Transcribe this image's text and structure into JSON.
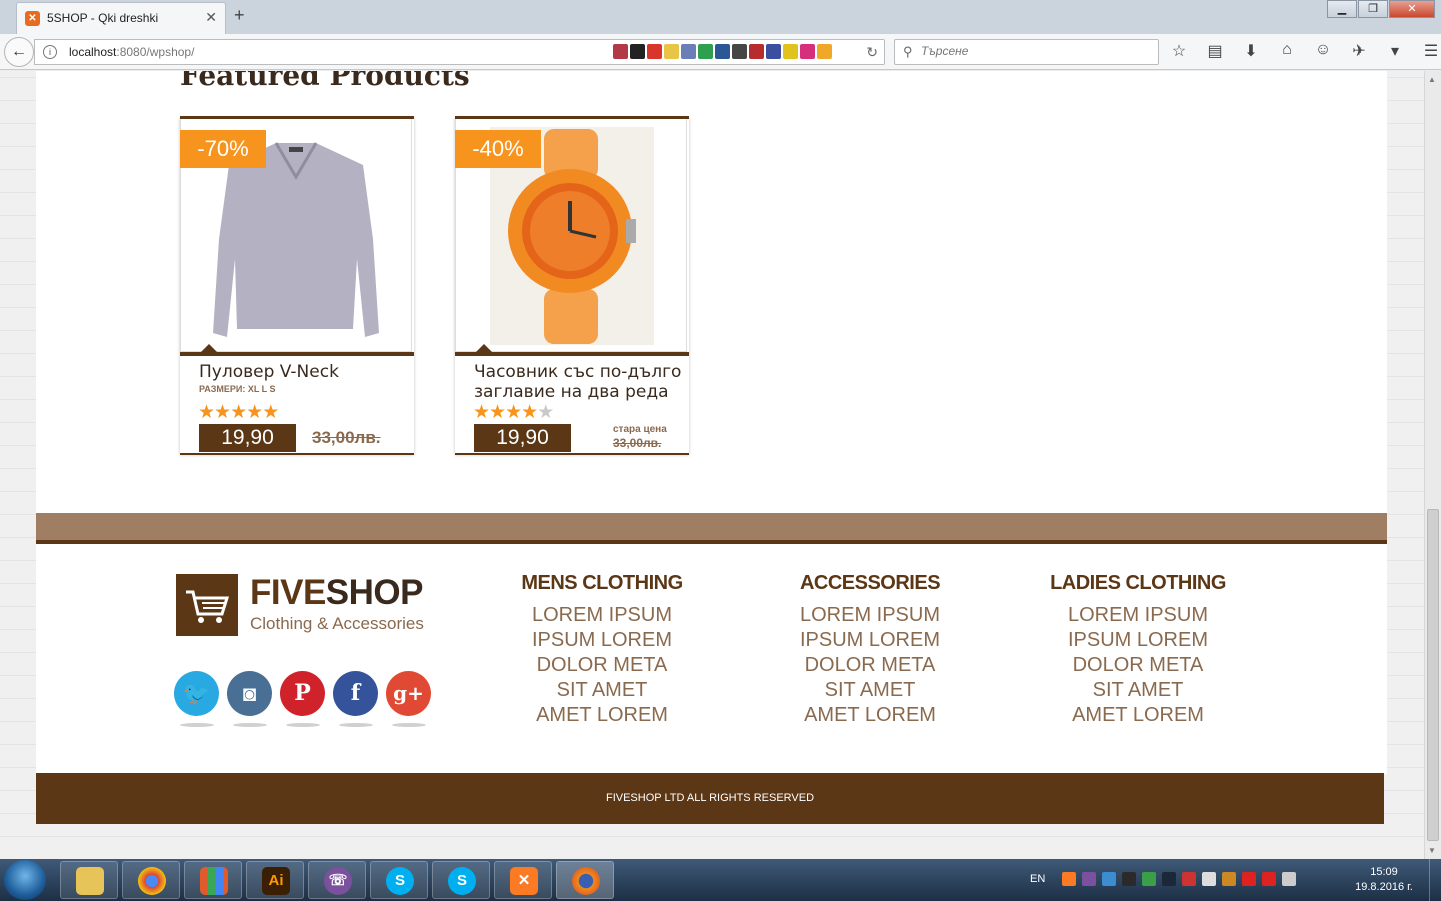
{
  "browser": {
    "tab_title": "5SHOP - Qki dreshki",
    "tab_favicon": "xampp-icon",
    "new_tab": "+",
    "url_host": "localhost",
    "url_rest": ":8080/wpshop/",
    "search_placeholder": "Търсене",
    "window_buttons": [
      "minimize",
      "maximize",
      "close"
    ]
  },
  "page": {
    "featured_title": "Featured Products",
    "products": [
      {
        "discount": "-70%",
        "name": "Пуловер V-Neck",
        "sizes": "РАЗМЕРИ: XL L S",
        "rating": 5,
        "price": "19,90",
        "old_price": "33,00лв.",
        "image": "grey-sweater"
      },
      {
        "discount": "-40%",
        "name": "Часовник със по-дълго заглавие на два реда",
        "old_price_label": "стара цена",
        "rating": 4,
        "price": "19,90",
        "old_price": "33,00лв.",
        "image": "orange-watch"
      }
    ]
  },
  "footer": {
    "brand_part1": "FIVE",
    "brand_part2": "SHOP",
    "tagline": "Clothing & Accessories",
    "social": [
      {
        "name": "twitter",
        "glyph": "🐦",
        "color": "#29a9e1"
      },
      {
        "name": "instagram",
        "glyph": "◙",
        "color": "#4a6f95"
      },
      {
        "name": "pinterest",
        "glyph": "P",
        "color": "#d0222b"
      },
      {
        "name": "facebook",
        "glyph": "f",
        "color": "#34539a"
      },
      {
        "name": "google-plus",
        "glyph": "g+",
        "color": "#e04a35"
      }
    ],
    "columns": [
      {
        "title": "MENS CLOTHING",
        "links": [
          "LOREM IPSUM",
          "IPSUM LOREM",
          "DOLOR META",
          "SIT AMET",
          "AMET LOREM"
        ]
      },
      {
        "title": "ACCESSORIES",
        "links": [
          "LOREM IPSUM",
          "IPSUM LOREM",
          "DOLOR META",
          "SIT AMET",
          "AMET LOREM"
        ]
      },
      {
        "title": "LADIES CLOTHING",
        "links": [
          "LOREM IPSUM",
          "IPSUM LOREM",
          "DOLOR META",
          "SIT AMET",
          "AMET LOREM"
        ]
      }
    ],
    "copyright": "FIVESHOP LTD ALL RIGHTS RESERVED"
  },
  "taskbar": {
    "apps": [
      "file-explorer",
      "chrome",
      "app-grid",
      "Ai",
      "viber",
      "skype",
      "skype",
      "xampp",
      "firefox"
    ],
    "language": "EN",
    "time": "15:09",
    "date": "19.8.2016 г."
  },
  "colors": {
    "brand_brown": "#5c3716",
    "light_brown": "#a07e64",
    "accent_orange": "#f7941d"
  }
}
